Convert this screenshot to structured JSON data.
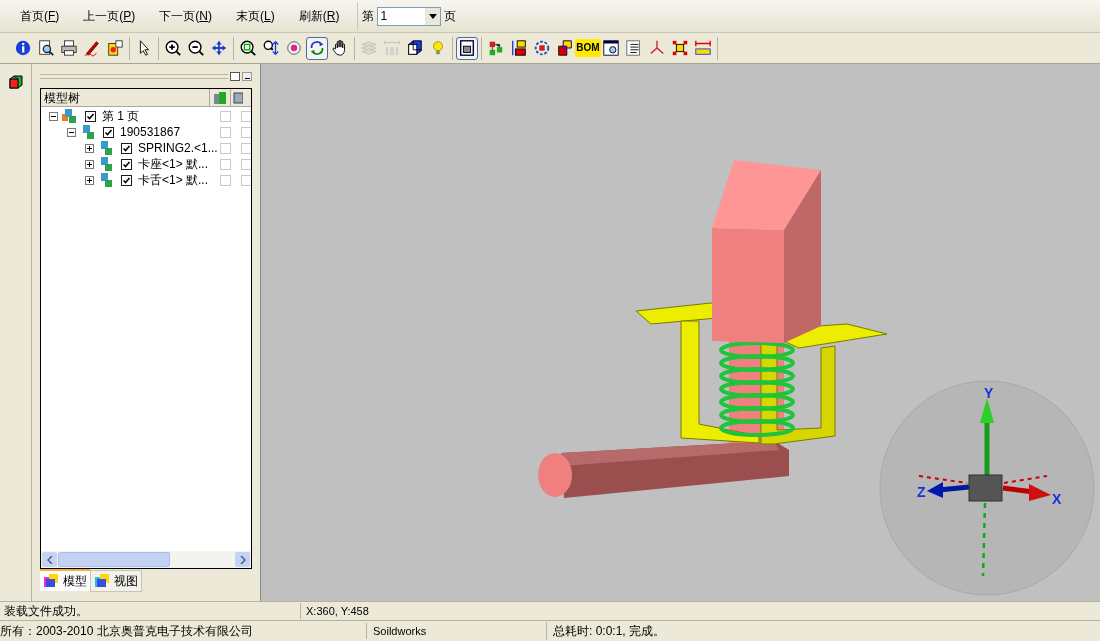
{
  "menu": [
    {
      "label": "首页(F)"
    },
    {
      "label": "上一页(P)"
    },
    {
      "label": "下一页(N)"
    },
    {
      "label": "末页(L)"
    },
    {
      "label": "刷新(R)"
    }
  ],
  "page_field": {
    "prefix": "第",
    "value": "1",
    "suffix": "页"
  },
  "toolbar": [
    [
      {
        "selected": false,
        "disabled": false
      },
      {
        "selected": false,
        "disabled": false
      },
      {
        "selected": false,
        "disabled": false
      },
      {
        "selected": false,
        "disabled": false
      },
      {
        "selected": false,
        "disabled": false
      }
    ],
    [
      {
        "selected": false,
        "disabled": false
      }
    ],
    [
      {
        "selected": false,
        "disabled": false
      },
      {
        "selected": false,
        "disabled": false
      },
      {
        "selected": false,
        "disabled": false
      }
    ],
    [
      {
        "selected": false,
        "disabled": false
      },
      {
        "selected": false,
        "disabled": false
      },
      {
        "selected": false,
        "disabled": false
      },
      {
        "selected": true,
        "disabled": false
      },
      {
        "selected": false,
        "disabled": false
      }
    ],
    [
      {
        "selected": false,
        "disabled": true
      },
      {
        "selected": false,
        "disabled": true
      },
      {
        "selected": false,
        "disabled": false
      },
      {
        "selected": false,
        "disabled": false
      }
    ],
    [
      {
        "selected": true,
        "disabled": false
      }
    ],
    [
      {
        "selected": false,
        "disabled": false
      },
      {
        "selected": false,
        "disabled": false
      },
      {
        "selected": false,
        "disabled": false
      },
      {
        "selected": false,
        "disabled": false
      },
      {
        "selected": false,
        "disabled": false,
        "label": "BOM"
      },
      {
        "selected": false,
        "disabled": false
      },
      {
        "selected": false,
        "disabled": false
      },
      {
        "selected": false,
        "disabled": false
      },
      {
        "selected": false,
        "disabled": false
      },
      {
        "selected": false,
        "disabled": false
      }
    ]
  ],
  "tree_panel": {
    "header": "模型树",
    "nodes": [
      {
        "label": "第 1 页",
        "checked": true,
        "expanded": true,
        "column_checks": [
          false,
          false
        ],
        "children": [
          {
            "label": "190531867",
            "checked": true,
            "expanded": true,
            "column_checks": [
              false,
              false
            ],
            "children": [
              {
                "label": "SPRING2.<1...",
                "checked": true,
                "expanded": false,
                "column_checks": [
                  false,
                  false
                ]
              },
              {
                "label": "卡座<1> 默...",
                "checked": true,
                "expanded": false,
                "column_checks": [
                  false,
                  false
                ]
              },
              {
                "label": "卡舌<1> 默...",
                "checked": true,
                "expanded": false,
                "column_checks": [
                  false,
                  false
                ]
              }
            ]
          }
        ]
      }
    ]
  },
  "tabs": [
    {
      "label": "模型",
      "selected": true
    },
    {
      "label": "视图",
      "selected": false
    }
  ],
  "viewport": {
    "axis_labels": {
      "x": "X",
      "y": "Y",
      "z": "Z"
    }
  },
  "status_bar": {
    "message": "装载文件成功。",
    "coordinates": "X:360, Y:458"
  },
  "footer": {
    "copyright": "所有：2003-2010 北京奥普克电子技术有限公司",
    "source": "Soildworks",
    "timing": "总耗时: 0:0:1, 完成。"
  }
}
